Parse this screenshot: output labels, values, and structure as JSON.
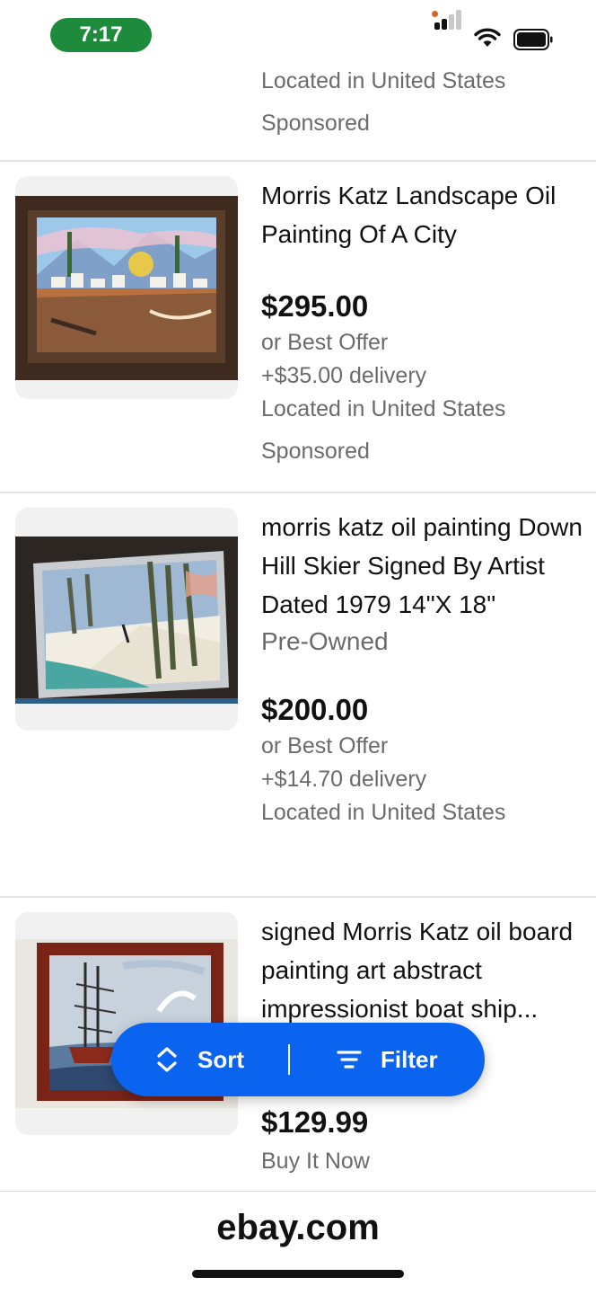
{
  "status": {
    "time": "7:17"
  },
  "top_partial": {
    "location": "Located in United States",
    "sponsored": "Sponsored"
  },
  "items": [
    {
      "title": "Morris Katz Landscape Oil Painting Of A City",
      "price": "$295.00",
      "offer": "or Best Offer",
      "delivery": "+$35.00 delivery",
      "location": "Located in United States",
      "sponsored": "Sponsored"
    },
    {
      "title": "morris katz oil painting Down Hill Skier Signed By Artist Dated 1979 14\"X 18\"",
      "condition": "Pre-Owned",
      "price": "$200.00",
      "offer": "or Best Offer",
      "delivery": "+$14.70 delivery",
      "location": "Located in United States"
    },
    {
      "title": "signed Morris Katz oil board painting art abstract impressionist boat ship...",
      "price": "$129.99",
      "buy_now": "Buy It Now"
    }
  ],
  "sort_filter": {
    "sort_label": "Sort",
    "filter_label": "Filter"
  },
  "browser": {
    "url": "ebay.com"
  },
  "colors": {
    "accent": "#0a64f0",
    "green": "#1e8a3c",
    "muted_text": "#6b6b6b"
  },
  "icons": [
    "signal-icon",
    "wifi-icon",
    "battery-icon",
    "sort-icon",
    "filter-icon"
  ]
}
